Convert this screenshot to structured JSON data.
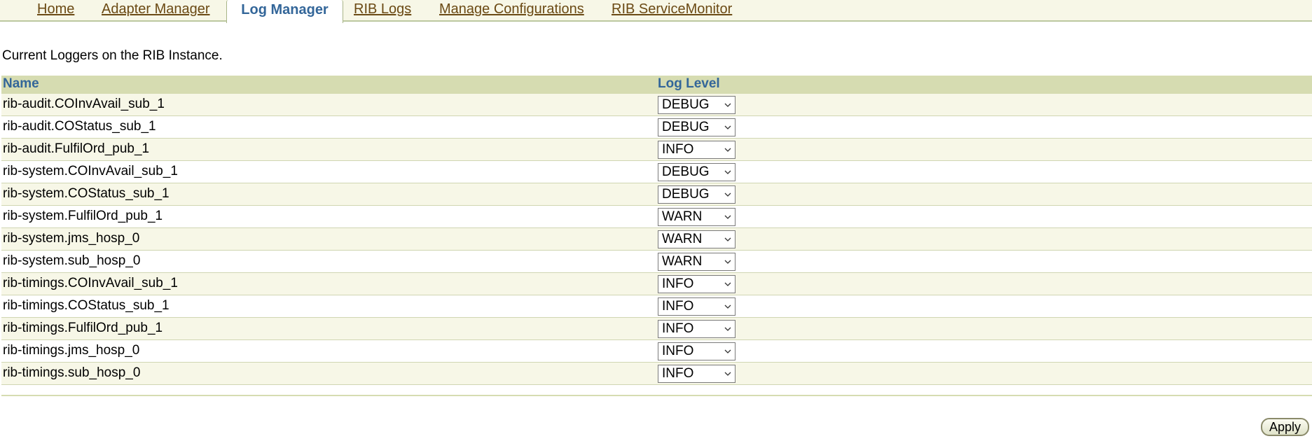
{
  "tabs": [
    {
      "label": "Home",
      "active": false
    },
    {
      "label": "Adapter Manager",
      "active": false
    },
    {
      "label": "Log Manager",
      "active": true
    },
    {
      "label": "RIB Logs",
      "active": false
    },
    {
      "label": "Manage Configurations",
      "active": false
    },
    {
      "label": "RIB ServiceMonitor",
      "active": false
    }
  ],
  "intro_text": "Current Loggers on the RIB Instance.",
  "table": {
    "columns": [
      "Name",
      "Log Level"
    ],
    "rows": [
      {
        "name": "rib-audit.COInvAvail_sub_1",
        "level": "DEBUG"
      },
      {
        "name": "rib-audit.COStatus_sub_1",
        "level": "DEBUG"
      },
      {
        "name": "rib-audit.FulfilOrd_pub_1",
        "level": "INFO"
      },
      {
        "name": "rib-system.COInvAvail_sub_1",
        "level": "DEBUG"
      },
      {
        "name": "rib-system.COStatus_sub_1",
        "level": "DEBUG"
      },
      {
        "name": "rib-system.FulfilOrd_pub_1",
        "level": "WARN"
      },
      {
        "name": "rib-system.jms_hosp_0",
        "level": "WARN"
      },
      {
        "name": "rib-system.sub_hosp_0",
        "level": "WARN"
      },
      {
        "name": "rib-timings.COInvAvail_sub_1",
        "level": "INFO"
      },
      {
        "name": "rib-timings.COStatus_sub_1",
        "level": "INFO"
      },
      {
        "name": "rib-timings.FulfilOrd_pub_1",
        "level": "INFO"
      },
      {
        "name": "rib-timings.jms_hosp_0",
        "level": "INFO"
      },
      {
        "name": "rib-timings.sub_hosp_0",
        "level": "INFO"
      }
    ]
  },
  "apply_label": "Apply",
  "colors": {
    "tab_link": "#6b4a14",
    "tab_active": "#336699",
    "header_bg": "#d6dcb1",
    "row_alt_bg": "#f7f7e7",
    "header_text": "#336699"
  },
  "icons": {
    "select_chevron": "chevron-down-icon"
  }
}
